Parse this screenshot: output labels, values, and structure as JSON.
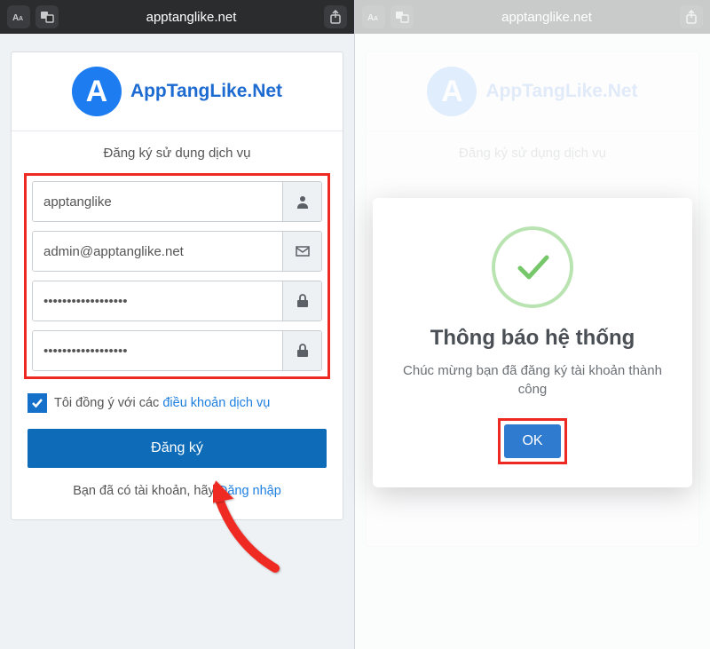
{
  "browser": {
    "url": "apptanglike.net"
  },
  "logo": {
    "letter": "A",
    "text": "AppTangLike.Net"
  },
  "left": {
    "section_title": "Đăng ký sử dụng dịch vụ",
    "fields": {
      "username": {
        "value": "apptanglike",
        "icon": "user-icon"
      },
      "email": {
        "value": "admin@apptanglike.net",
        "icon": "envelope-icon"
      },
      "password": {
        "value": "••••••••••••••••••",
        "icon": "lock-icon"
      },
      "password_confirm": {
        "value": "••••••••••••••••••",
        "icon": "lock-icon"
      }
    },
    "terms": {
      "checked": true,
      "text": "Tôi đồng ý với các ",
      "link": "điều khoản dịch vụ"
    },
    "submit": "Đăng ký",
    "login_prompt": "Bạn đã có tài khoản, hãy ",
    "login_link": "Đăng nhập"
  },
  "right": {
    "section_title": "Đăng ký sử dụng dịch vụ",
    "modal": {
      "title": "Thông báo hệ thống",
      "message": "Chúc mừng bạn đã đăng ký tài khoản thành công",
      "ok": "OK"
    }
  },
  "colors": {
    "accent": "#1d7cf0",
    "highlight": "#ee2921",
    "button": "#0e6bb7"
  }
}
